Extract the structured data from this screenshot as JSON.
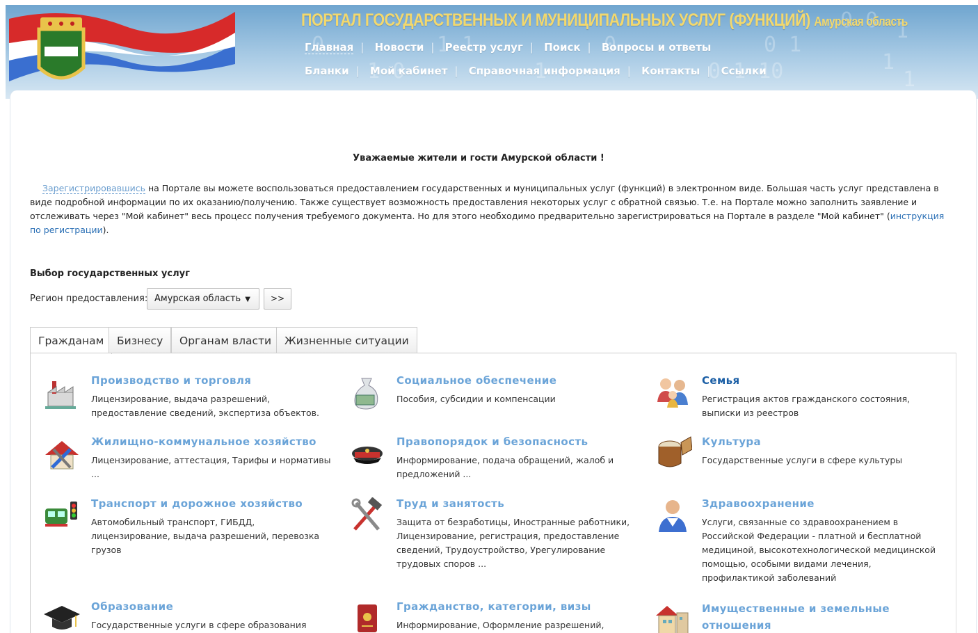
{
  "header": {
    "title": "ПОРТАЛ ГОСУДАРСТВЕННЫХ И МУНИЦИПАЛЬНЫХ УСЛУГ (ФУНКЦИЙ)",
    "region": "Амурская область",
    "nav_row1": [
      "Главная",
      "Новости",
      "Реестр услуг",
      "Поиск",
      "Вопросы и ответы"
    ],
    "nav_row2": [
      "Бланки",
      "Мой кабинет",
      "Справочная информация",
      "Контакты",
      "Ссылки"
    ]
  },
  "greeting": "Уважаемые жители и гости Амурской области !",
  "intro": {
    "register_link": "Зарегистрировавшись",
    "text": " на Портале вы можете воспользоваться предоставлением государственных и муниципальных услуг (функций) в электронном виде. Большая часть услуг представлена в виде подробной информации по их оказанию/получению. Также существует возможность предоставления некоторых услуг с обратной связью. Т.е. на Портале можно заполнить заявление и отслеживать через \"Мой кабинет\" весь процесс получения требуемого документа. Но для этого необходимо предварительно зарегистрироваться на Портале в разделе \"Мой кабинет\" (",
    "instruction_link": "инструкция по регистрации",
    "tail": ")."
  },
  "services": {
    "title": "Выбор государственных услуг",
    "region_label": "Регион предоставления:",
    "region_value": "Амурская область",
    "go_label": ">>"
  },
  "tabs": [
    "Гражданам",
    "Бизнесу",
    "Органам власти",
    "Жизненные ситуации"
  ],
  "categories": [
    {
      "name": "Производство и торговля",
      "desc": "Лицензирование, выдача разрешений, предоставление сведений, экспертиза объектов.",
      "icon": "factory-icon"
    },
    {
      "name": "Социальное обеспечение",
      "desc": "Пособия, субсидии и компенсации",
      "icon": "money-bag-icon"
    },
    {
      "name": "Семья",
      "desc": "Регистрация актов гражданского состояния, выписки из реестров",
      "icon": "family-icon"
    },
    {
      "name": "Жилищно-коммунальное хозяйство",
      "desc": "Лицензирование, аттестация, Тарифы и нормативы ...",
      "icon": "house-tools-icon"
    },
    {
      "name": "Правопорядок и безопасность",
      "desc": "Информирование, подача обращений, жалоб и предложений ...",
      "icon": "police-cap-icon"
    },
    {
      "name": "Культура",
      "desc": "Государственные услуги в сфере культуры",
      "icon": "drum-icon"
    },
    {
      "name": "Транспорт и дорожное хозяйство",
      "desc": "Автомобильный транспорт, ГИБДД, лицензирование, выдача разрешений, перевозка грузов",
      "icon": "train-traffic-light-icon"
    },
    {
      "name": "Труд и занятость",
      "desc": "Защита от безработицы, Иностранные работники, Лицензирование, регистрация, предоставление сведений, Трудоустройство, Урегулирование трудовых споров ...",
      "icon": "hammer-wrench-icon"
    },
    {
      "name": "Здравоохранение",
      "desc": "Услуги, связанные со здравоохранением в Российской Федерации - платной и бесплатной медициной, высокотехнологической медицинской помощью, особыми видами лечения, профилактикой заболеваний",
      "icon": "doctor-icon"
    },
    {
      "name": "Образование",
      "desc": "Государственные услуги в сфере образования",
      "icon": "graduation-cap-icon"
    },
    {
      "name": "Гражданство, категории, визы",
      "desc": "Информирование, Оформление разрешений,",
      "icon": "passport-icon"
    },
    {
      "name": "Имущественные и земельные отношения",
      "desc": "",
      "icon": "buildings-icon"
    }
  ],
  "colors": {
    "link": "#6ba4d8",
    "title": "#f2d86e",
    "header_bg": "#8fb8dc"
  }
}
